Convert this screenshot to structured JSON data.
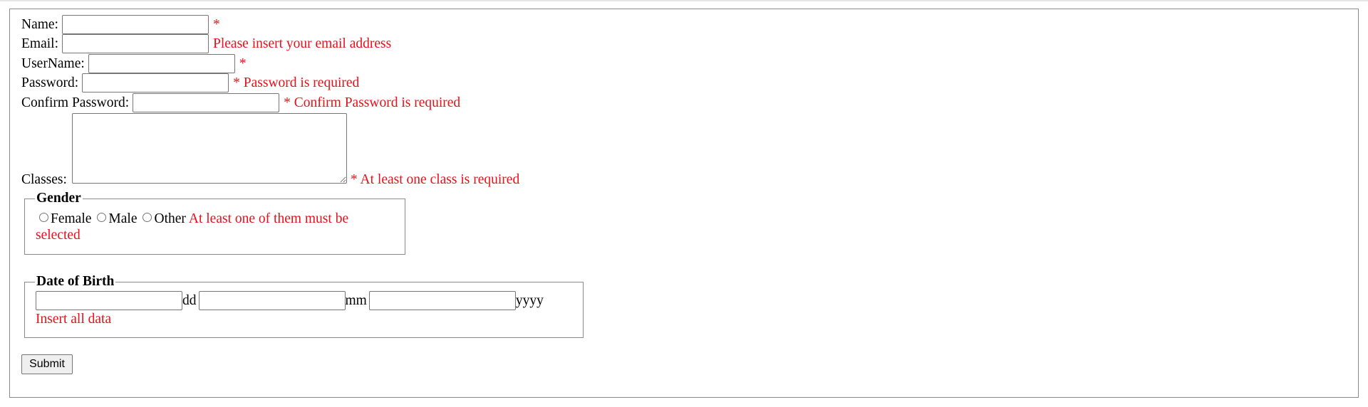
{
  "form": {
    "name": {
      "label": "Name:",
      "value": "",
      "error": "*"
    },
    "email": {
      "label": "Email:",
      "value": "",
      "error": "Please insert your email address"
    },
    "username": {
      "label": "UserName:",
      "value": "",
      "error": "*"
    },
    "password": {
      "label": "Password:",
      "value": "",
      "error": "* Password is required"
    },
    "confirm_password": {
      "label": "Confirm Password:",
      "value": "",
      "error": "* Confirm Password is required"
    },
    "classes": {
      "label": "Classes:",
      "value": "",
      "error": "* At least one class is required"
    },
    "gender": {
      "legend": "Gender",
      "options": [
        "Female",
        "Male",
        "Other"
      ],
      "error_line1": "At least one of them must be",
      "error_line2": "selected"
    },
    "dob": {
      "legend": "Date of Birth",
      "day_value": "",
      "day_unit": "dd",
      "month_value": "",
      "month_unit": "mm",
      "year_value": "",
      "year_unit": "yyyy",
      "error": "Insert all data"
    },
    "submit_label": "Submit"
  },
  "colors": {
    "error": "#e8101a",
    "border": "#767676"
  }
}
